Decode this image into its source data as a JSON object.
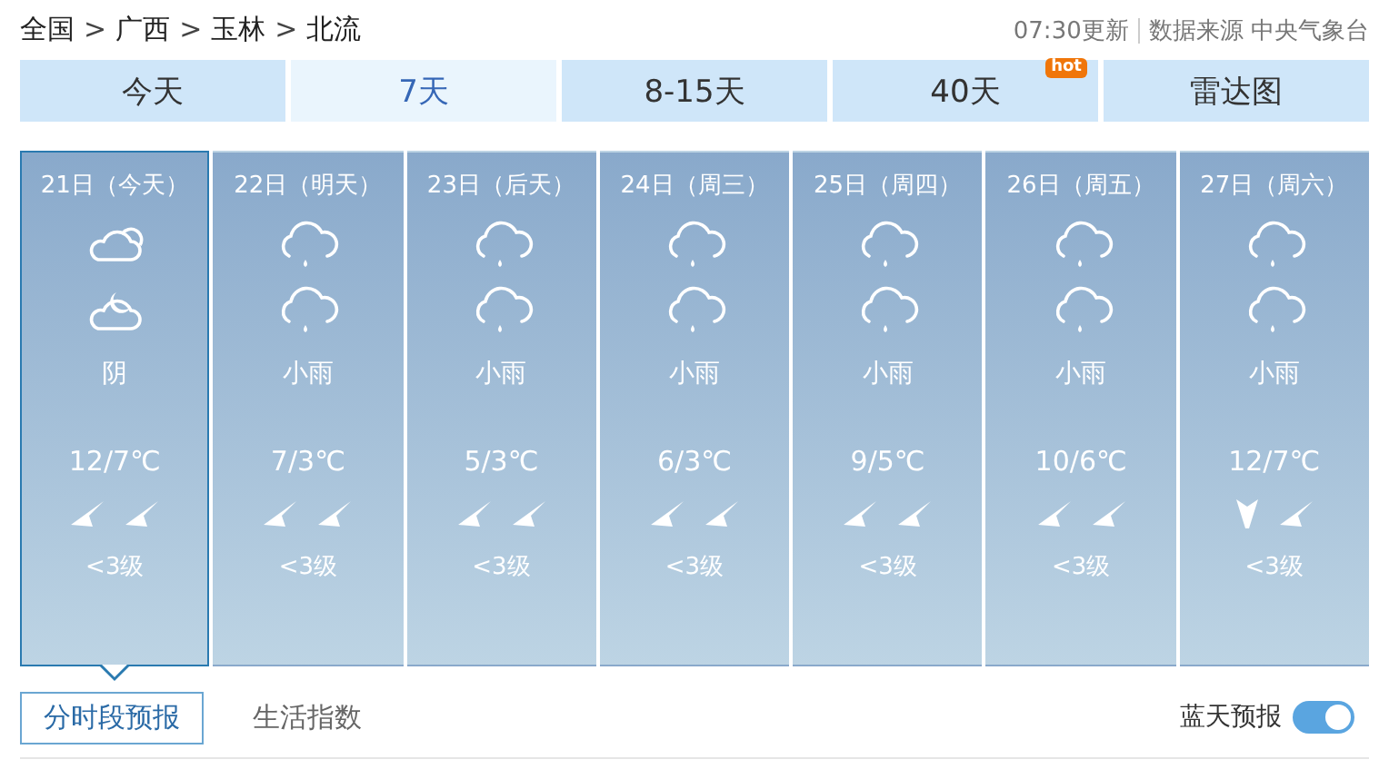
{
  "breadcrumb": [
    "全国",
    "广西",
    "玉林",
    "北流"
  ],
  "breadcrumb_separator": ">",
  "update_time": "07:30更新",
  "source": "数据来源 中央气象台",
  "tabs": [
    {
      "label": "今天",
      "selected": false
    },
    {
      "label": "7天",
      "selected": true
    },
    {
      "label": "8-15天",
      "selected": false
    },
    {
      "label": "40天",
      "selected": false,
      "badge": "hot"
    },
    {
      "label": "雷达图",
      "selected": false
    }
  ],
  "days": [
    {
      "date": "21日（今天）",
      "selected": true,
      "icons": [
        {
          "kind": "cloudy"
        },
        {
          "kind": "moon"
        }
      ],
      "weather": "阴",
      "temp": "12/7℃",
      "arrows": [
        {
          "kind": "ne"
        },
        {
          "kind": "ne"
        }
      ],
      "wind": "<3级"
    },
    {
      "date": "22日（明天）",
      "selected": false,
      "icons": [
        {
          "kind": "rain"
        },
        {
          "kind": "rain"
        }
      ],
      "weather": "小雨",
      "temp": "7/3℃",
      "arrows": [
        {
          "kind": "ne"
        },
        {
          "kind": "ne"
        }
      ],
      "wind": "<3级"
    },
    {
      "date": "23日（后天）",
      "selected": false,
      "icons": [
        {
          "kind": "rain"
        },
        {
          "kind": "rain"
        }
      ],
      "weather": "小雨",
      "temp": "5/3℃",
      "arrows": [
        {
          "kind": "ne"
        },
        {
          "kind": "ne"
        }
      ],
      "wind": "<3级"
    },
    {
      "date": "24日（周三）",
      "selected": false,
      "icons": [
        {
          "kind": "rain"
        },
        {
          "kind": "rain"
        }
      ],
      "weather": "小雨",
      "temp": "6/3℃",
      "arrows": [
        {
          "kind": "ne"
        },
        {
          "kind": "ne"
        }
      ],
      "wind": "<3级"
    },
    {
      "date": "25日（周四）",
      "selected": false,
      "icons": [
        {
          "kind": "rain"
        },
        {
          "kind": "rain"
        }
      ],
      "weather": "小雨",
      "temp": "9/5℃",
      "arrows": [
        {
          "kind": "ne"
        },
        {
          "kind": "ne"
        }
      ],
      "wind": "<3级"
    },
    {
      "date": "26日（周五）",
      "selected": false,
      "icons": [
        {
          "kind": "rain"
        },
        {
          "kind": "rain"
        }
      ],
      "weather": "小雨",
      "temp": "10/6℃",
      "arrows": [
        {
          "kind": "ne"
        },
        {
          "kind": "ne"
        }
      ],
      "wind": "<3级"
    },
    {
      "date": "27日（周六）",
      "selected": false,
      "icons": [
        {
          "kind": "rain"
        },
        {
          "kind": "rain"
        }
      ],
      "weather": "小雨",
      "temp": "12/7℃",
      "arrows": [
        {
          "kind": "down"
        },
        {
          "kind": "ne"
        }
      ],
      "wind": "<3级"
    }
  ],
  "sub_tabs": [
    {
      "label": "分时段预报",
      "selected": true
    },
    {
      "label": "生活指数",
      "selected": false
    }
  ],
  "blue_sky": {
    "label": "蓝天预报",
    "on": true
  }
}
